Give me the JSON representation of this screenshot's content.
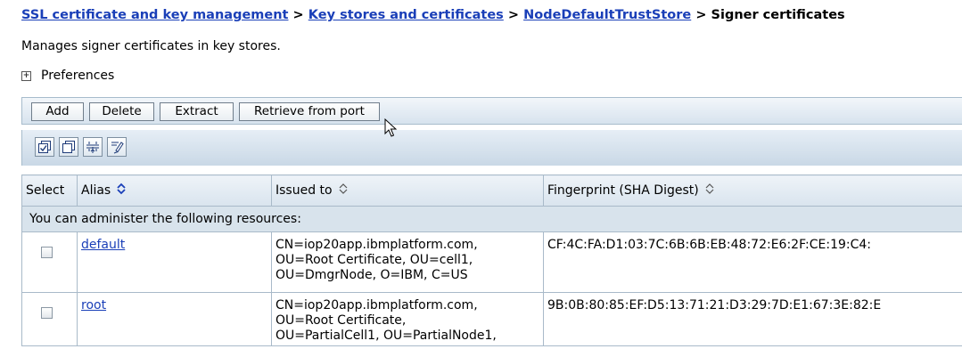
{
  "breadcrumb": {
    "links": [
      "SSL certificate and key management",
      "Key stores and certificates",
      "NodeDefaultTrustStore"
    ],
    "separator": ">",
    "current": "Signer certificates"
  },
  "description": "Manages signer certificates in key stores.",
  "preferences": {
    "expander": "+",
    "label": "Preferences"
  },
  "toolbar": {
    "add": "Add",
    "delete": "Delete",
    "extract": "Extract",
    "retrieve": "Retrieve from port"
  },
  "icon_toolbar": [
    "select-all-icon",
    "deselect-all-icon",
    "show-filter-icon",
    "edit-filter-icon"
  ],
  "table": {
    "headers": {
      "select": "Select",
      "alias": "Alias",
      "issued_to": "Issued to",
      "fingerprint": "Fingerprint (SHA Digest)"
    },
    "admin_text": "You can administer the following resources:",
    "rows": [
      {
        "alias": "default",
        "issued_to": [
          "CN=iop20app.ibmplatform.com,",
          "OU=Root Certificate, OU=cell1,",
          "OU=DmgrNode, O=IBM, C=US"
        ],
        "fingerprint": "CF:4C:FA:D1:03:7C:6B:6B:EB:48:72:E6:2F:CE:19:C4:",
        "checked": false
      },
      {
        "alias": "root",
        "issued_to": [
          "CN=iop20app.ibmplatform.com,",
          "OU=Root Certificate,",
          "OU=PartialCell1, OU=PartialNode1,"
        ],
        "fingerprint": "9B:0B:80:85:EF:D5:13:71:21:D3:29:7D:E1:67:3E:82:E",
        "checked": false
      }
    ]
  },
  "colors": {
    "link": "#1a3fb8",
    "header_bg": "#d9e4ee",
    "admin_row_bg": "#d8e3ec",
    "border": "#a9bac9"
  }
}
